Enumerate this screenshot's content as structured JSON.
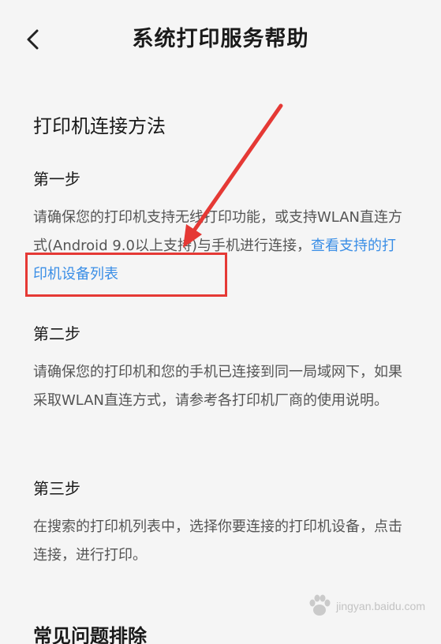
{
  "header": {
    "title": "系统打印服务帮助",
    "back_icon": "chevron-left-icon"
  },
  "content": {
    "section_title": "打印机连接方法",
    "steps": [
      {
        "title": "第一步",
        "text": "请确保您的打印机支持无线打印功能，或支持WLAN直连方式(Android 9.0以上支持)与手机进行连接，",
        "link": "查看支持的打印机设备列表"
      },
      {
        "title": "第二步",
        "text": "请确保您的打印机和您的手机已连接到同一局域网下，如果采取WLAN直连方式，请参考各打印机厂商的使用说明。"
      },
      {
        "title": "第三步",
        "text": "在搜索的打印机列表中，选择你要连接的打印机设备，点击连接，进行打印。"
      }
    ],
    "next_section_title": "常见问题排除"
  },
  "colors": {
    "link": "#3a8ee6",
    "annotation": "#e53935",
    "background": "#f5f5f5"
  },
  "watermark": {
    "text": "jingyan.baidu.com"
  }
}
